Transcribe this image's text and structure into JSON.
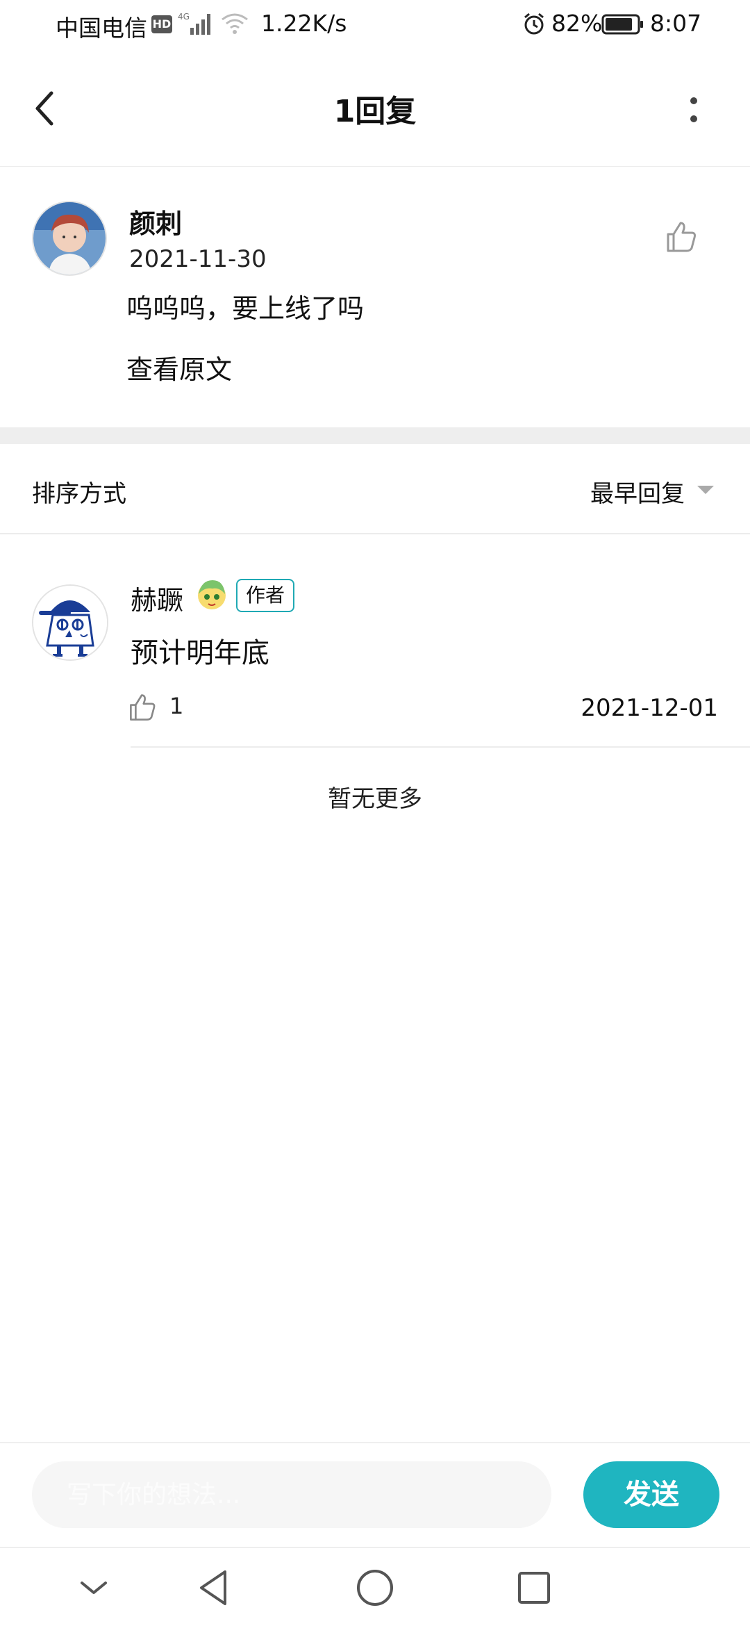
{
  "status_bar": {
    "carrier": "中国电信",
    "hd": "HD",
    "network": "4G",
    "speed": "1.22K/s",
    "battery": "82%",
    "time": "8:07"
  },
  "header": {
    "title": "1回复",
    "back_icon": "chevron-left-icon",
    "more_icon": "more-vertical-icon"
  },
  "original_comment": {
    "username": "颜刺",
    "date": "2021-11-30",
    "text": "呜呜呜，要上线了吗",
    "view_original_label": "查看原文",
    "like_icon": "thumbs-up-icon"
  },
  "sort": {
    "label": "排序方式",
    "selected": "最早回复"
  },
  "replies": [
    {
      "username": "赫蹶",
      "author_tag": "作者",
      "text": "预计明年底",
      "like_count": "1",
      "date": "2021-12-01"
    }
  ],
  "no_more_label": "暂无更多",
  "input": {
    "placeholder": "写下你的想法...",
    "send_label": "发送"
  },
  "colors": {
    "accent": "#1fb5c0",
    "tag_border": "#1fa9b4",
    "band": "#eeeeee"
  }
}
